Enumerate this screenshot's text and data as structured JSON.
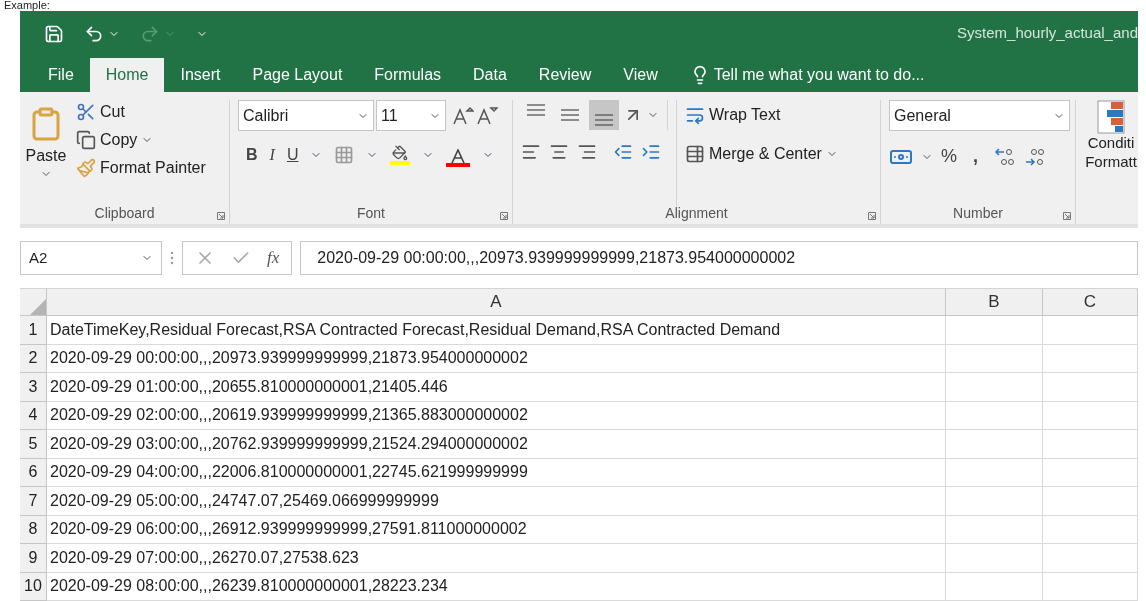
{
  "caption": "Example:",
  "window": {
    "title": "System_hourly_actual_and"
  },
  "tabs": [
    {
      "label": "File",
      "selected": false
    },
    {
      "label": "Home",
      "selected": true
    },
    {
      "label": "Insert",
      "selected": false
    },
    {
      "label": "Page Layout",
      "selected": false
    },
    {
      "label": "Formulas",
      "selected": false
    },
    {
      "label": "Data",
      "selected": false
    },
    {
      "label": "Review",
      "selected": false
    },
    {
      "label": "View",
      "selected": false
    }
  ],
  "tell_me": {
    "placeholder": "Tell me what you want to do..."
  },
  "clipboard": {
    "label": "Clipboard",
    "paste": "Paste",
    "cut": "Cut",
    "copy": "Copy",
    "format_painter": "Format Painter"
  },
  "font": {
    "label": "Font",
    "name": "Calibri",
    "size": "11",
    "bold": "B",
    "italic": "I",
    "underline": "U"
  },
  "alignment": {
    "label": "Alignment",
    "vertical": [
      {
        "kind": "top",
        "selected": false
      },
      {
        "kind": "middle",
        "selected": false
      },
      {
        "kind": "bottom",
        "selected": true
      }
    ],
    "wrap_text": "Wrap Text",
    "merge_center": "Merge & Center"
  },
  "number": {
    "label": "Number",
    "format": "General",
    "percent": "%",
    "comma": ","
  },
  "styles": {
    "conditional_formatting": [
      "Conditi",
      "Formatt"
    ]
  },
  "formula_bar": {
    "name_box": "A2",
    "fx": "fx",
    "value": "2020-09-29 00:00:00,,,20973.939999999999,21873.954000000002"
  },
  "sheet": {
    "columns": [
      "A",
      "B",
      "C"
    ],
    "rows": [
      {
        "number": "1",
        "cells": [
          "DateTimeKey,Residual Forecast,RSA Contracted Forecast,Residual Demand,RSA Contracted Demand"
        ]
      },
      {
        "number": "2",
        "cells": [
          "2020-09-29 00:00:00,,,20973.939999999999,21873.954000000002"
        ]
      },
      {
        "number": "3",
        "cells": [
          "2020-09-29 01:00:00,,,20655.810000000001,21405.446"
        ]
      },
      {
        "number": "4",
        "cells": [
          "2020-09-29 02:00:00,,,20619.939999999999,21365.883000000002"
        ]
      },
      {
        "number": "5",
        "cells": [
          "2020-09-29 03:00:00,,,20762.939999999999,21524.294000000002"
        ]
      },
      {
        "number": "6",
        "cells": [
          "2020-09-29 04:00:00,,,22006.810000000001,22745.621999999999"
        ]
      },
      {
        "number": "7",
        "cells": [
          "2020-09-29 05:00:00,,,24747.07,25469.066999999999"
        ]
      },
      {
        "number": "8",
        "cells": [
          "2020-09-29 06:00:00,,,26912.939999999999,27591.811000000002"
        ]
      },
      {
        "number": "9",
        "cells": [
          "2020-09-29 07:00:00,,,26270.07,27538.623"
        ]
      },
      {
        "number": "10",
        "cells": [
          "2020-09-29 08:00:00,,,26239.810000000001,28223.234"
        ]
      }
    ]
  }
}
